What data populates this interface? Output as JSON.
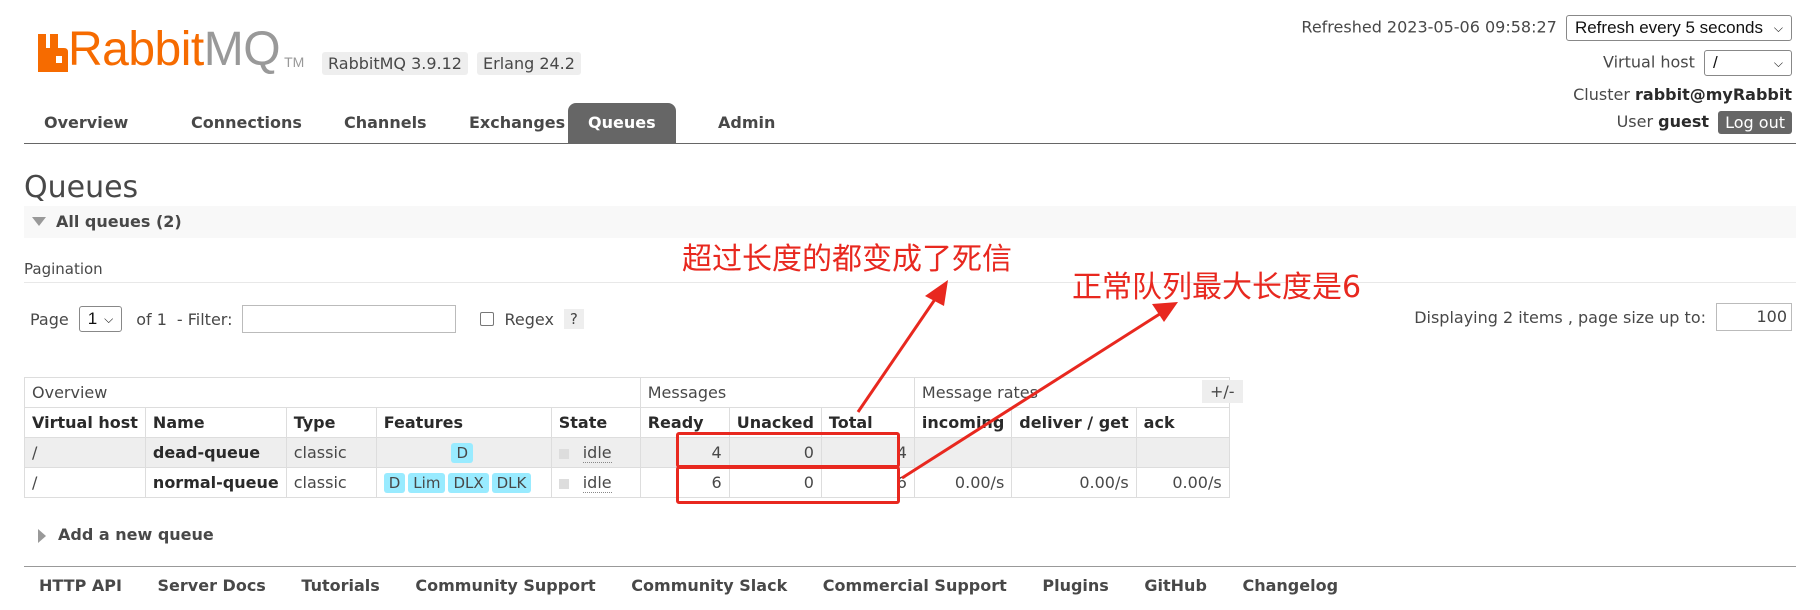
{
  "brand": {
    "rabbit": "Rabbit",
    "mq": "MQ",
    "tm": "TM"
  },
  "versions": {
    "rabbitmq": "RabbitMQ 3.9.12",
    "erlang": "Erlang 24.2"
  },
  "status": {
    "refreshed": "Refreshed 2023-05-06 09:58:27",
    "refresh_select": "Refresh every 5 seconds",
    "vhost_label": "Virtual host",
    "vhost_value": "/",
    "cluster_label": "Cluster",
    "cluster_value": "rabbit@myRabbit",
    "user_label": "User",
    "user_value": "guest",
    "logout": "Log out"
  },
  "nav": {
    "tabs": [
      "Overview",
      "Connections",
      "Channels",
      "Exchanges",
      "Queues",
      "Admin"
    ],
    "active": "Queues"
  },
  "page": {
    "title": "Queues",
    "section": "All queues (2)",
    "pagination_title": "Pagination",
    "page_label": "Page",
    "page_value": "1",
    "of_label": "of 1",
    "filter_label": "- Filter:",
    "filter_value": "",
    "regex_label": "Regex",
    "help": "?",
    "displaying": "Displaying 2 items , page size up to:",
    "page_size": "100"
  },
  "table": {
    "groups": [
      "Overview",
      "Messages",
      "Message rates"
    ],
    "plus_minus": "+/-",
    "columns": [
      "Virtual host",
      "Name",
      "Type",
      "Features",
      "State",
      "Ready",
      "Unacked",
      "Total",
      "incoming",
      "deliver / get",
      "ack"
    ],
    "rows": [
      {
        "vhost": "/",
        "name": "dead-queue",
        "type": "classic",
        "features": [
          "D"
        ],
        "state": "idle",
        "ready": "4",
        "unacked": "0",
        "total": "4",
        "incoming": "",
        "deliver": "",
        "ack": ""
      },
      {
        "vhost": "/",
        "name": "normal-queue",
        "type": "classic",
        "features": [
          "D",
          "Lim",
          "DLX",
          "DLK"
        ],
        "state": "idle",
        "ready": "6",
        "unacked": "0",
        "total": "6",
        "incoming": "0.00/s",
        "deliver": "0.00/s",
        "ack": "0.00/s"
      }
    ]
  },
  "add_queue": "Add a new queue",
  "footer": [
    "HTTP API",
    "Server Docs",
    "Tutorials",
    "Community Support",
    "Community Slack",
    "Commercial Support",
    "Plugins",
    "GitHub",
    "Changelog"
  ],
  "annotations": {
    "dead_letter": "超过长度的都变成了死信",
    "max_length": "正常队列最大长度是6"
  },
  "colors": {
    "brand_orange": "#f66b00",
    "tab_active": "#666666",
    "annotation_red": "#e8281f",
    "feature_badge": "#99ebff"
  }
}
